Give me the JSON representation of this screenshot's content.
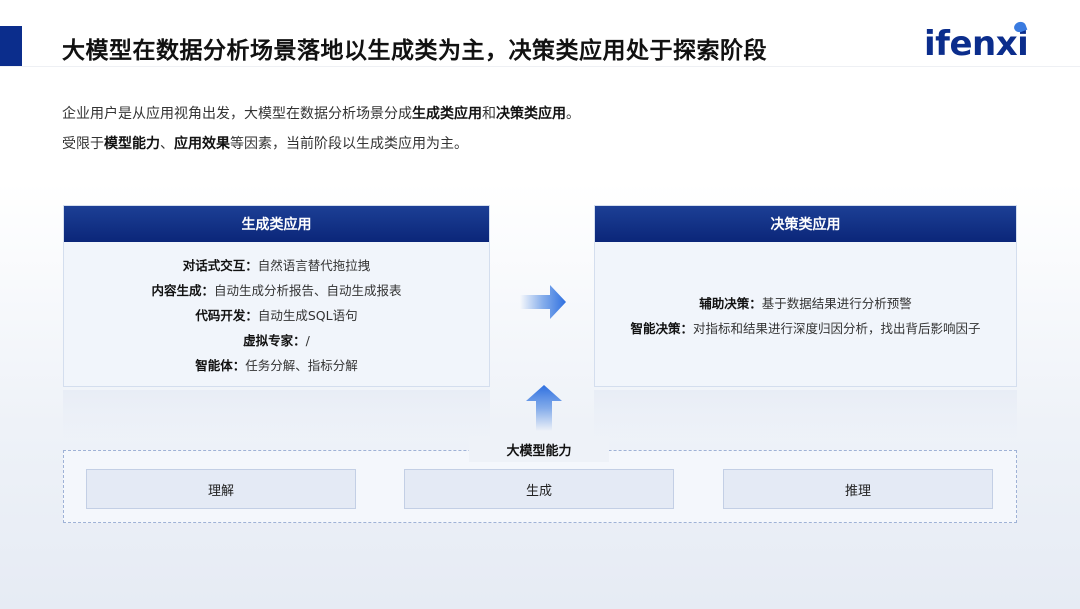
{
  "header": {
    "title": "大模型在数据分析场景落地以生成类为主，决策类应用处于探索阶段",
    "logo": "ifenxi"
  },
  "intro": {
    "line1_prefix": "企业用户是从应用视角出发，大模型在数据分析场景分成",
    "line1_bold1": "生成类应用",
    "line1_mid": "和",
    "line1_bold2": "决策类应用",
    "line1_suffix": "。",
    "line2_prefix": "受限于",
    "line2_bold1": "模型能力",
    "line2_sep": "、",
    "line2_bold2": "应用效果",
    "line2_suffix": "等因素，当前阶段以生成类应用为主。"
  },
  "generative": {
    "title": "生成类应用",
    "items": [
      {
        "label": "对话式交互：",
        "text": "自然语言替代拖拉拽"
      },
      {
        "label": "内容生成：",
        "text": "自动生成分析报告、自动生成报表"
      },
      {
        "label": "代码开发：",
        "text": "自动生成SQL语句"
      },
      {
        "label": "虚拟专家：",
        "text": "/"
      },
      {
        "label": "智能体：",
        "text": "任务分解、指标分解"
      }
    ]
  },
  "decision": {
    "title": "决策类应用",
    "items": [
      {
        "label": "辅助决策：",
        "text": "基于数据结果进行分析预警"
      },
      {
        "label": "智能决策：",
        "text": "对指标和结果进行深度归因分析，找出背后影响因子"
      }
    ]
  },
  "capability": {
    "title": "大模型能力",
    "items": [
      "理解",
      "生成",
      "推理"
    ]
  },
  "colors": {
    "brand": "#0b2d8c",
    "panel_header": "#0b2679",
    "arrow": "#3a7be0"
  }
}
